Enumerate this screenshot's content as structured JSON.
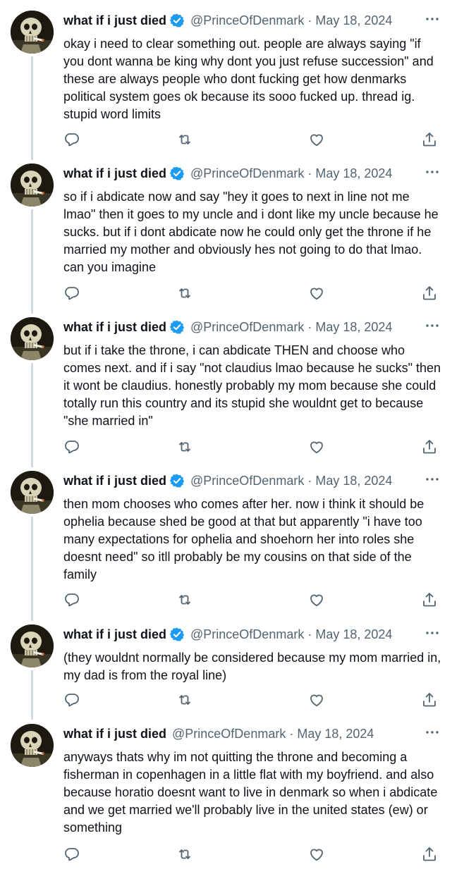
{
  "author": {
    "name": "what if i just died",
    "handle": "@PrinceOfDenmark",
    "date": "May 18, 2024"
  },
  "separator": "·",
  "colors": {
    "verified": "#1d9bf0",
    "secondary_text": "#536471",
    "thread_line": "#cfd9de"
  },
  "icons": {
    "more": "more-horizontal-icon",
    "reply": "reply-icon",
    "retweet": "retweet-icon",
    "like": "like-icon",
    "share": "share-icon",
    "verified": "verified-badge-icon"
  },
  "tweets": [
    {
      "verified": true,
      "text": "okay i need to clear something out. people are always saying \"if you dont wanna be king why dont you just refuse succession\" and these are always people who dont fucking get how denmarks political system goes ok because its sooo fucked up. thread ig. stupid word limits"
    },
    {
      "verified": true,
      "text": "so if i abdicate now and say \"hey it goes to next in line not me lmao\" then it goes to my uncle and i dont like my uncle because he sucks. but if i dont abdicate now he could only get the throne if he married my mother and obviously hes not going to do that lmao. can you imagine"
    },
    {
      "verified": true,
      "text": "but if i take the throne, i can abdicate THEN and choose who comes next. and if i say \"not claudius lmao because he sucks\" then it wont be claudius. honestly probably my mom because she could totally run this country and its stupid she wouldnt get to because \"she married in\""
    },
    {
      "verified": true,
      "text": "then mom chooses who comes after her. now i think it should be ophelia because shed be good at that but apparently \"i have too many expectations for ophelia and shoehorn her into roles she doesnt need\" so itll probably be my cousins on that side of the family"
    },
    {
      "verified": true,
      "text": "(they wouldnt normally be considered because my mom married in, my dad is from the royal line)"
    },
    {
      "verified": false,
      "text": "anyways thats why im not quitting the throne and becoming a fisherman in copenhagen in a little flat with my boyfriend. and also because horatio doesnt want to live in denmark so when i abdicate and we get married we'll probably live in the united states (ew) or something"
    }
  ]
}
